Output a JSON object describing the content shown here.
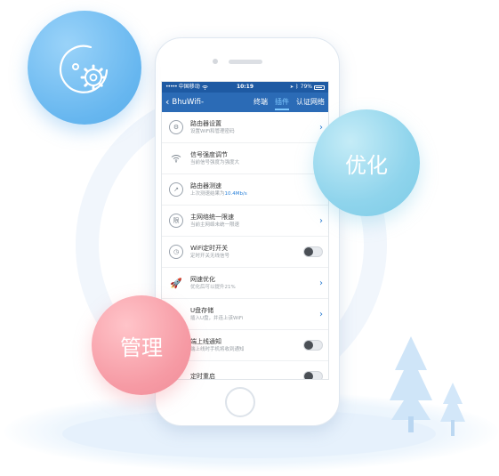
{
  "status_bar": {
    "signal": "•••••",
    "carrier": "中国移动",
    "time": "10:19",
    "battery_text": "79%"
  },
  "nav": {
    "back_icon": "chevron-left-icon",
    "title": "BhuWifi-",
    "tabs": [
      {
        "label": "终端",
        "active": false
      },
      {
        "label": "插件",
        "active": true
      },
      {
        "label": "认证网络",
        "active": false
      }
    ]
  },
  "settings": [
    {
      "icon": "router-settings-icon",
      "title": "路由器设置",
      "subtitle": "设置WiFi和管理密码",
      "control": "chevron"
    },
    {
      "icon": "wifi-signal-icon",
      "title": "信号强度调节",
      "subtitle": "当前信号强度为强度大",
      "control": "none"
    },
    {
      "icon": "speedometer-icon",
      "title": "路由器测速",
      "subtitle_prefix": "上次测速结果为",
      "subtitle_highlight": "10.4Mb/s",
      "control": "none"
    },
    {
      "icon": "speed-limit-icon",
      "title": "主网络统一限速",
      "subtitle": "当前主网络未统一限速",
      "control": "chevron"
    },
    {
      "icon": "clock-timer-icon",
      "title": "WiFi定时开关",
      "subtitle": "定时开关无线信号",
      "control": "toggle"
    },
    {
      "icon": "rocket-icon",
      "title": "网速优化",
      "subtitle": "优化后可以提升21%",
      "control": "chevron"
    },
    {
      "icon": "usb-storage-icon",
      "title": "U盘存储",
      "subtitle": "插入U盘，并连上该WiFi",
      "control": "chevron"
    },
    {
      "icon": "bell-notify-icon",
      "title": "端上线通知",
      "subtitle": "端上线时手机将收到通知",
      "control": "toggle"
    },
    {
      "icon": "restart-timer-icon",
      "title": "定时重启",
      "subtitle": "",
      "control": "toggle"
    }
  ],
  "bubbles": {
    "gear": {
      "icon": "gear-settings-icon"
    },
    "optimize": {
      "label": "优化"
    },
    "manage": {
      "label": "管理"
    }
  },
  "colors": {
    "navbar": "#2b6bb6",
    "accent": "#2b82d9",
    "bubble_blue": "#66b6ef",
    "bubble_cyan": "#8fd4ec",
    "bubble_pink": "#f69aa4"
  }
}
